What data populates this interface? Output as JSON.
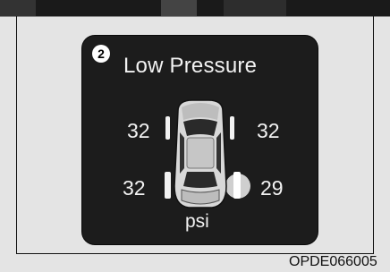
{
  "indicator_marker": "❷",
  "title": "Low Pressure",
  "tires": {
    "front_left": "32",
    "front_right": "32",
    "rear_left": "32",
    "rear_right": "29"
  },
  "low_tire": "rear_right",
  "unit": "psi",
  "figure_code": "OPDE066005",
  "colors": {
    "panel_background": "#1c1c1c",
    "text": "#f2f2f2",
    "page_background": "#e4e4e4"
  }
}
